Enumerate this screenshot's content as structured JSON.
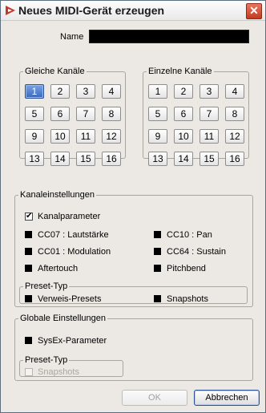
{
  "window": {
    "title": "Neues MIDI-Gerät erzeugen",
    "close_glyph": "✕"
  },
  "name": {
    "label": "Name",
    "value": ""
  },
  "gleiche_kanaele": {
    "legend": "Gleiche Kanäle",
    "selected": "1",
    "channels": [
      "1",
      "2",
      "3",
      "4",
      "5",
      "6",
      "7",
      "8",
      "9",
      "10",
      "11",
      "12",
      "13",
      "14",
      "15",
      "16"
    ]
  },
  "einzelne_kanaele": {
    "legend": "Einzelne Kanäle",
    "channels": [
      "1",
      "2",
      "3",
      "4",
      "5",
      "6",
      "7",
      "8",
      "9",
      "10",
      "11",
      "12",
      "13",
      "14",
      "15",
      "16"
    ]
  },
  "kanaleinstellungen": {
    "legend": "Kanaleinstellungen",
    "kanalparameter": {
      "label": "Kanalparameter",
      "checked": true
    },
    "cc07": "CC07 : Lautstärke",
    "cc10": "CC10 : Pan",
    "cc01": "CC01 : Modulation",
    "cc64": "CC64 : Sustain",
    "aftertouch": "Aftertouch",
    "pitchbend": "Pitchbend",
    "preset_typ": {
      "legend": "Preset-Typ",
      "verweis": "Verweis-Presets",
      "snapshots": "Snapshots"
    }
  },
  "globale": {
    "legend": "Globale Einstellungen",
    "sysex": "SysEx-Parameter",
    "preset_typ": {
      "legend": "Preset-Typ",
      "snapshots": {
        "label": "Snapshots",
        "checked": false,
        "disabled": true
      }
    }
  },
  "buttons": {
    "ok": "OK",
    "cancel": "Abbrechen"
  },
  "colors": {
    "accent": "#3a67bd",
    "close": "#c4391f",
    "window_bg": "#ece9e4"
  },
  "icons": {
    "app": "cubase-triangle-icon",
    "close": "close-icon"
  }
}
